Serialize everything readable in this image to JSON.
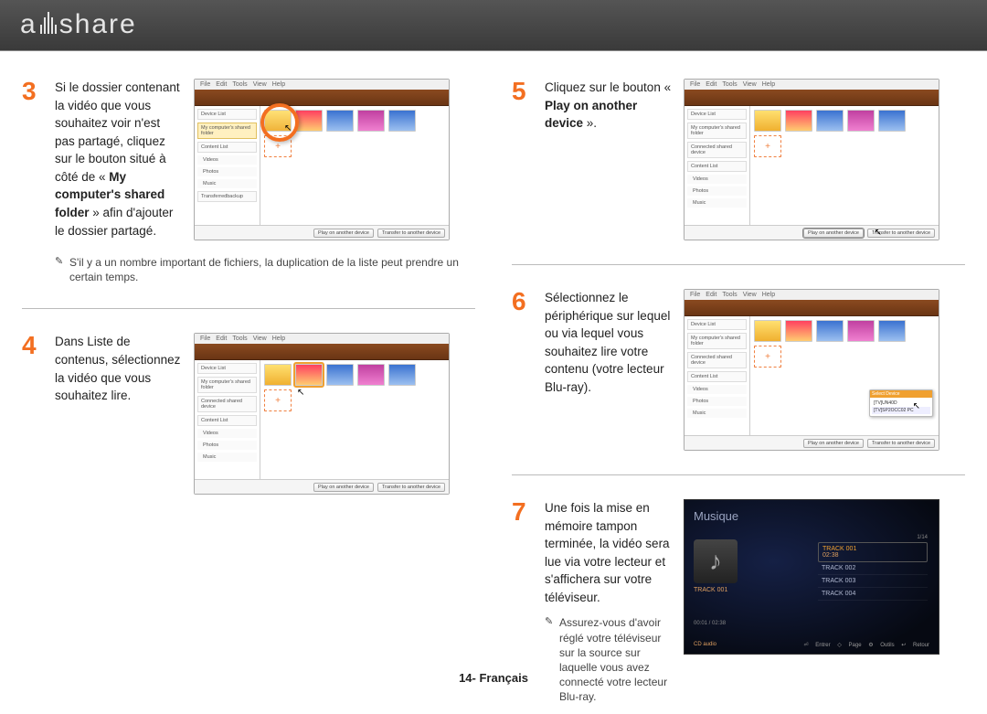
{
  "logo_prefix": "a",
  "logo_suffix": "share",
  "footer": "14- Français",
  "sidebar_labels": {
    "device": "Device List",
    "shared": "My computer's shared folder",
    "content": "Content List",
    "connected": "Connected shared device",
    "videos": "Videos",
    "photos": "Photos",
    "music": "Music",
    "transfer": "Transferredbackup"
  },
  "buttons": {
    "play": "Play on another device",
    "transfer": "Transfer to another device"
  },
  "popup": {
    "title": "Select Device",
    "line1": "[TV]UN40D",
    "line2": "[TV]SP2OCC02 PC"
  },
  "tv": {
    "title": "Musique",
    "track_label": "TRACK 001",
    "track1": "TRACK 001",
    "track1_time": "02:38",
    "track2": "TRACK 002",
    "track3": "TRACK 003",
    "track4": "TRACK 004",
    "cd": "CD audio",
    "time": "00:01 / 02:38",
    "k_enter": "Entrer",
    "k_page": "Page",
    "k_tools": "Outils",
    "k_return": "Retour",
    "page": "1/14"
  },
  "steps": {
    "3": {
      "num": "3",
      "text_a": "Si le dossier contenant la vidéo que vous souhaitez voir n'est pas partagé, cliquez sur le bouton situé à côté de « ",
      "text_bold": "My computer's shared folder",
      "text_b": " » afin d'ajouter le dossier partagé.",
      "note": "S'il y a un nombre important de fichiers, la duplication de la liste peut prendre un certain temps."
    },
    "4": {
      "num": "4",
      "text": "Dans Liste de contenus, sélectionnez la vidéo que vous souhaitez lire."
    },
    "5": {
      "num": "5",
      "text_a": "Cliquez sur le bouton « ",
      "text_bold": "Play on another device",
      "text_b": " »."
    },
    "6": {
      "num": "6",
      "text": "Sélectionnez le périphérique sur lequel ou via lequel vous souhaitez lire votre contenu (votre lecteur Blu-ray)."
    },
    "7": {
      "num": "7",
      "text": "Une fois la mise en mémoire tampon terminée, la vidéo sera lue via votre lecteur et s'affichera sur votre téléviseur.",
      "note": "Assurez-vous d'avoir réglé votre téléviseur sur la source sur laquelle vous avez connecté votre lecteur Blu-ray."
    }
  }
}
